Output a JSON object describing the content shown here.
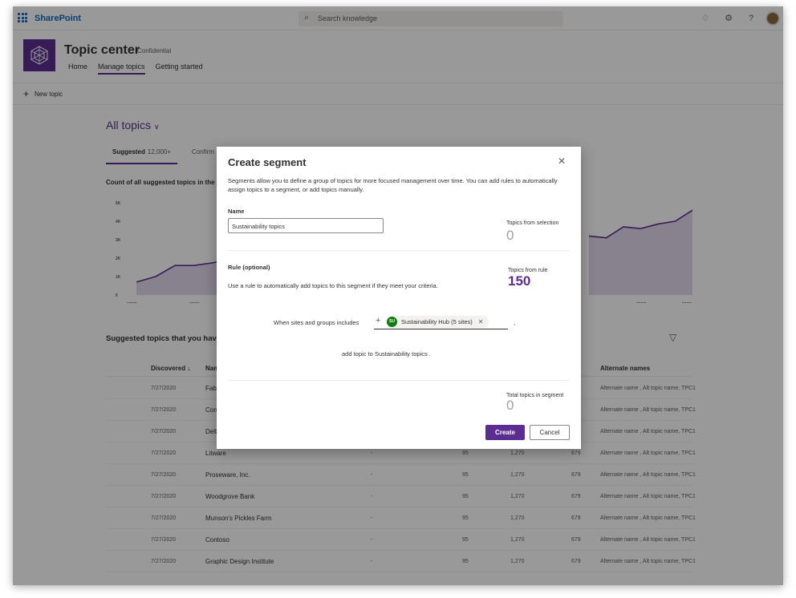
{
  "suitebar": {
    "brand": "SharePoint",
    "search_placeholder": "Search knowledge",
    "icons": [
      "bell-icon",
      "gear-icon",
      "help-icon"
    ]
  },
  "site": {
    "title": "Topic center",
    "tag": "Confidential",
    "nav": [
      "Home",
      "Manage topics",
      "Getting started"
    ],
    "active_nav": "Manage topics"
  },
  "command_bar": {
    "new_topic": "New topic"
  },
  "main": {
    "view_title": "All topics",
    "pivots": [
      {
        "label": "Suggested",
        "count": "12,000+"
      },
      {
        "label": "Confirm"
      }
    ],
    "chart_title": "Count of all suggested topics in the",
    "table_title": "Suggested topics that you have"
  },
  "chart_data": {
    "type": "area",
    "title": "Count of all suggested topics in the",
    "ylim": [
      0,
      5000
    ],
    "y_ticks": [
      "5K",
      "4K",
      "3K",
      "2K",
      "1K",
      "0"
    ],
    "x_ticks": [
      "07/22",
      "07/25",
      "08/18",
      "08/21"
    ],
    "series": [
      {
        "values": [
          700,
          1000,
          1600,
          1600,
          1750,
          2000
        ]
      },
      {
        "values": [
          3200,
          3100,
          3700,
          3600,
          3850,
          4000,
          4600
        ]
      }
    ]
  },
  "table": {
    "columns": {
      "discovered": "Discovered",
      "name": "Name",
      "alternate": "Alternate names"
    },
    "rows": [
      {
        "date": "7/27/2020",
        "name": "Fabrikar",
        "alt": "Alternate name , Alt topic name, TPC1"
      },
      {
        "date": "7/27/2020",
        "name": "Consoli",
        "alt": "Alternate name , Alt topic name, TPC1"
      },
      {
        "date": "7/27/2020",
        "name": "Delta",
        "alt": "Alternate name , Alt topic name, TPC1"
      },
      {
        "date": "7/27/2020",
        "name": "Litware",
        "dash": "-",
        "v1": "95",
        "v2": "1,270",
        "v3": "679",
        "alt": "Alternate name , Alt topic name, TPC1"
      },
      {
        "date": "7/27/2020",
        "name": "Proseware, Inc.",
        "dash": "-",
        "v1": "95",
        "v2": "1,270",
        "v3": "679",
        "alt": "Alternate name , Alt topic name, TPC1"
      },
      {
        "date": "7/27/2020",
        "name": "Woodgrove Bank",
        "dash": "-",
        "v1": "95",
        "v2": "1,270",
        "v3": "679",
        "alt": "Alternate name , Alt topic name, TPC1"
      },
      {
        "date": "7/27/2020",
        "name": "Munson's Pickles Farm",
        "dash": "-",
        "v1": "95",
        "v2": "1,270",
        "v3": "679",
        "alt": "Alternate name , Alt topic name, TPC1"
      },
      {
        "date": "7/27/2020",
        "name": "Contoso",
        "dash": "-",
        "v1": "95",
        "v2": "1,270",
        "v3": "679",
        "alt": "Alternate name , Alt topic name, TPC1"
      },
      {
        "date": "7/27/2020",
        "name": "Graphic Design Institute",
        "dash": "-",
        "v1": "95",
        "v2": "1,270",
        "v3": "679",
        "alt": "Alternate name , Alt topic name, TPC1"
      }
    ]
  },
  "dialog": {
    "title": "Create segment",
    "description": "Segments allow you to define a group of topics for more focused management over time. You can add rules to automatically assign topics to a segment, or add topics manually.",
    "name_label": "Name",
    "name_value": "Sustainability topics",
    "topics_from_selection_label": "Topics from selection",
    "topics_from_selection_value": "0",
    "rule_label": "Rule (optional)",
    "rule_description": "Use a rule to automatically add topics to this segment if they meet your criteria.",
    "topics_from_rule_label": "Topics from rule",
    "topics_from_rule_value": "150",
    "when_text": "When sites and groups includes",
    "chip_initials": "SU",
    "chip_label": "Sustainability Hub (5 sites)",
    "add_topic_text": "add topic to  Sustainability topics  .",
    "total_label": "Total topics in segment",
    "total_value": "0",
    "create_label": "Create",
    "cancel_label": "Cancel",
    "accent_color": "#5c2d91"
  }
}
